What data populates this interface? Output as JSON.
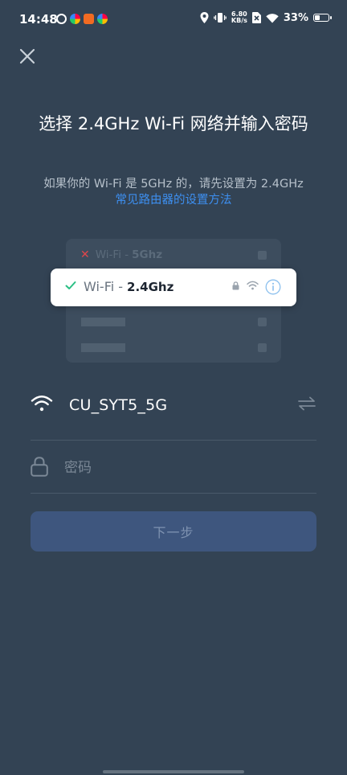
{
  "status_bar": {
    "time": "14:48",
    "net_speed_value": "6.80",
    "net_speed_unit": "KB/s",
    "battery_percent": "33%",
    "battery_level": 0.33
  },
  "title": "选择 2.4GHz Wi-Fi 网络并输入密码",
  "subtitle": "如果你的 Wi-Fi 是 5GHz 的，请先设置为 2.4GHz",
  "help_link": "常见路由器的设置方法",
  "illustration": {
    "row_5g_prefix": "Wi-Fi -",
    "row_5g_band": "5Ghz",
    "row_24_prefix": "Wi-Fi -",
    "row_24_band": "2.4Ghz"
  },
  "form": {
    "ssid": "CU_SYT5_5G",
    "password_placeholder": "密码",
    "password_value": "",
    "next_label": "下一步"
  },
  "colors": {
    "background": "#334354",
    "accent_link": "#3d8ff0",
    "check_green": "#2bbf84",
    "error_red": "#e0464b",
    "button_disabled": "#3e567e"
  },
  "icons": {
    "close": "close-icon",
    "check": "check-icon",
    "cross": "cross-icon",
    "lock_small": "lock-icon",
    "wifi_small": "wifi-icon",
    "info": "info-icon",
    "wifi": "wifi-icon",
    "swap": "swap-icon",
    "lock": "lock-icon"
  }
}
